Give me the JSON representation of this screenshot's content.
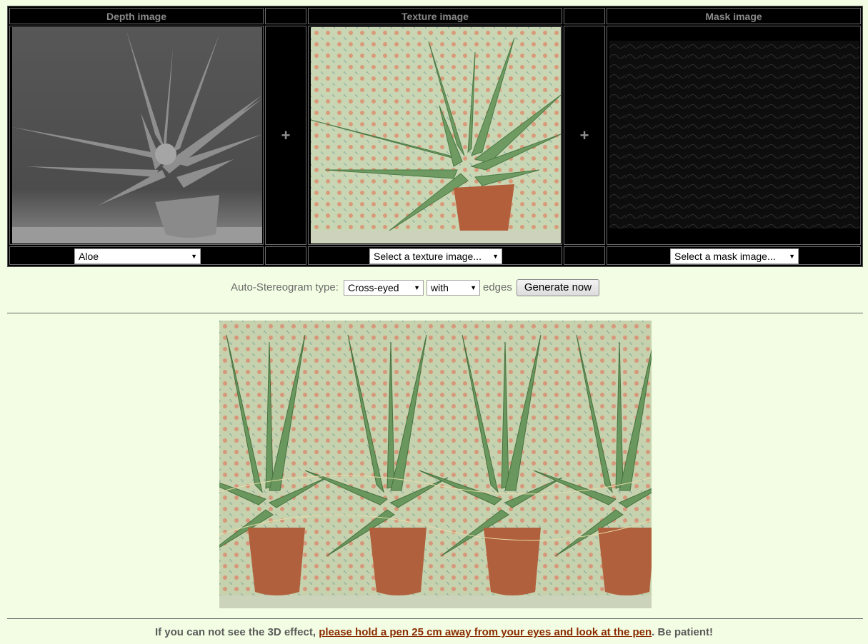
{
  "panels": {
    "depth": {
      "header": "Depth image",
      "select_value": "Aloe"
    },
    "texture": {
      "header": "Texture image",
      "select_value": "Select a texture image..."
    },
    "mask": {
      "header": "Mask image",
      "select_value": "Select a mask image..."
    },
    "plus_symbol": "+"
  },
  "controls": {
    "type_label": "Auto-Stereogram type:",
    "type_value": "Cross-eyed",
    "edges_value": "with",
    "edges_label": "edges",
    "generate_label": "Generate now"
  },
  "footer": {
    "prefix": "If you can not see the 3D effect, ",
    "link": "please hold a pen 25 cm away from your eyes and look at the pen",
    "suffix": ". Be patient!"
  },
  "colors": {
    "page_background": "#f2fde3",
    "panel_background": "#000000",
    "link_color": "#8b2a00"
  },
  "icons": {
    "plus": "plus-icon",
    "caret": "chevron-down-icon"
  }
}
